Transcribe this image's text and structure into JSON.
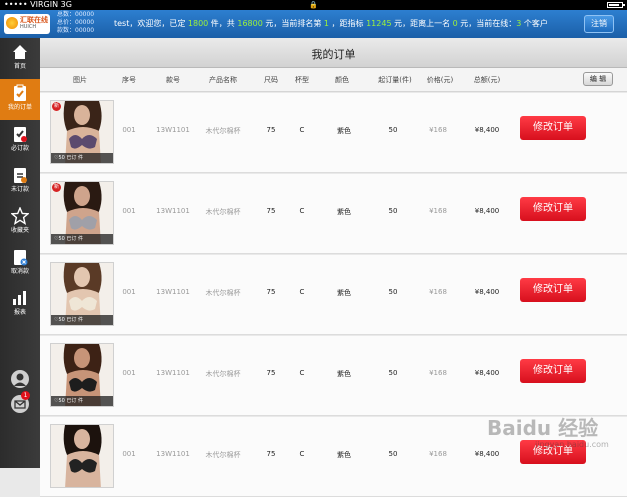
{
  "status_bar": {
    "carrier": "VIRGIN",
    "network": "3G"
  },
  "header": {
    "logo_text": "汇联在线",
    "logo_sub": "HUICH",
    "stats": [
      "总数：00000",
      "总价：00000",
      "款数：00000"
    ],
    "welcome": {
      "pre": "test，欢迎您，已定 ",
      "count": "1800",
      "mid1": " 件，共 ",
      "amount": "16800",
      "mid2": " 元，当前排名第 ",
      "rank": "1",
      "mid3": " ，距指标 ",
      "target": "11245",
      "mid4": " 元，距离上一名 ",
      "gap": "0",
      "mid5": " 元，当前在线：",
      "online": "3",
      "post": " 个客户"
    },
    "logout_label": "注销"
  },
  "sidebar": {
    "items": [
      {
        "label": "首页",
        "icon": "home-icon"
      },
      {
        "label": "我的订单",
        "icon": "order-icon",
        "active": true
      },
      {
        "label": "必订款",
        "icon": "must-order-icon"
      },
      {
        "label": "未订款",
        "icon": "unordered-icon"
      },
      {
        "label": "收藏夹",
        "icon": "star-icon"
      },
      {
        "label": "取消款",
        "icon": "cancel-icon"
      },
      {
        "label": "报表",
        "icon": "report-icon"
      }
    ],
    "bottom": [
      {
        "icon": "user-icon"
      },
      {
        "icon": "message-icon",
        "badge": "1"
      }
    ]
  },
  "page_title": "我的订单",
  "edit_label": "编 辑",
  "columns": [
    "图片",
    "序号",
    "款号",
    "产品名称",
    "尺码",
    "杯型",
    "颜色",
    "起订量(件)",
    "价格(元)",
    "总额(元)"
  ],
  "rows": [
    {
      "seq": "001",
      "style_no": "13W1101",
      "name": "木代尔棉杯",
      "size": "75",
      "cup": "C",
      "color": "紫色",
      "min_qty": "50",
      "price": "¥168",
      "total": "¥8,400",
      "thumb_caption": "♡50  已订    件",
      "is_new": true,
      "button": "修改订单"
    },
    {
      "seq": "001",
      "style_no": "13W1101",
      "name": "木代尔棉杯",
      "size": "75",
      "cup": "C",
      "color": "紫色",
      "min_qty": "50",
      "price": "¥168",
      "total": "¥8,400",
      "thumb_caption": "♡50  已订    件",
      "is_new": true,
      "button": "修改订单"
    },
    {
      "seq": "001",
      "style_no": "13W1101",
      "name": "木代尔棉杯",
      "size": "75",
      "cup": "C",
      "color": "紫色",
      "min_qty": "50",
      "price": "¥168",
      "total": "¥8,400",
      "thumb_caption": "♡50  已订    件",
      "is_new": false,
      "button": "修改订单"
    },
    {
      "seq": "001",
      "style_no": "13W1101",
      "name": "木代尔棉杯",
      "size": "75",
      "cup": "C",
      "color": "紫色",
      "min_qty": "50",
      "price": "¥168",
      "total": "¥8,400",
      "thumb_caption": "♡50  已订    件",
      "is_new": false,
      "button": "修改订单"
    },
    {
      "seq": "001",
      "style_no": "13W1101",
      "name": "木代尔棉杯",
      "size": "75",
      "cup": "C",
      "color": "紫色",
      "min_qty": "50",
      "price": "¥168",
      "total": "¥8,400",
      "thumb_caption": "",
      "is_new": false,
      "button": "修改订单"
    }
  ],
  "watermark": {
    "text": "Baidu 经验",
    "sub": "jingyan.baidu.com"
  },
  "colors": {
    "accent": "#e07c12",
    "header_blue": "#1b5fa8",
    "button_red": "#e21b27",
    "highlight": "#9cf13b"
  }
}
